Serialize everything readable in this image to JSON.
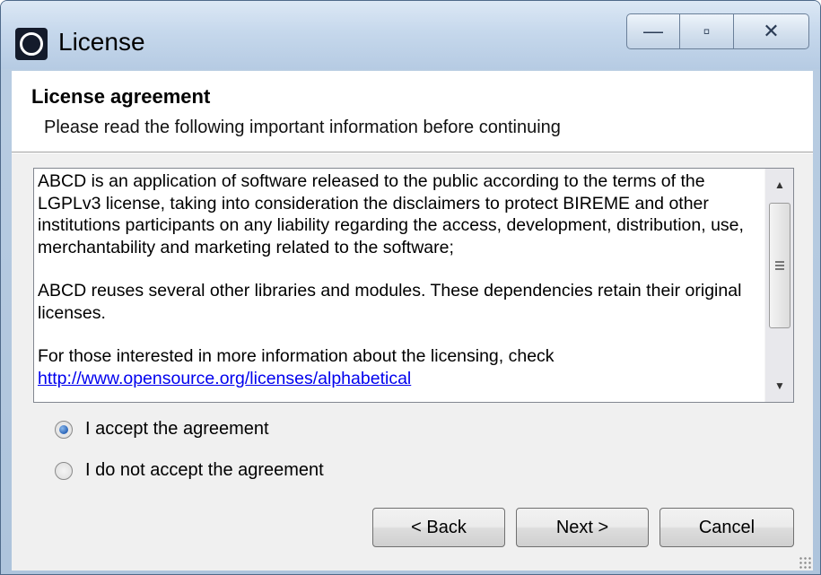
{
  "window": {
    "title": "License",
    "caption_buttons": {
      "minimize_glyph": "—",
      "maximize_glyph": "▫",
      "close_glyph": "✕"
    }
  },
  "header": {
    "title": "License agreement",
    "subtitle": "Please read the following important information before continuing"
  },
  "license": {
    "paragraphs": [
      "ABCD is an application of software released to the public according to the terms of the LGPLv3 license, taking into consideration the disclaimers to protect BIREME and other institutions participants on any liability regarding the access, development, distribution, use, merchantability and marketing related to the software;",
      "ABCD reuses several other libraries and modules. These dependencies retain their original licenses.",
      "For those interested in more information about the licensing, check"
    ],
    "link": "http://www.opensource.org/licenses/alphabetical",
    "scroll_up_glyph": "▲",
    "scroll_down_glyph": "▼"
  },
  "options": {
    "accept_label": "I accept the agreement",
    "decline_label": "I do not accept the agreement",
    "selected": "accept"
  },
  "buttons": {
    "back": "< Back",
    "next": "Next >",
    "cancel": "Cancel"
  }
}
